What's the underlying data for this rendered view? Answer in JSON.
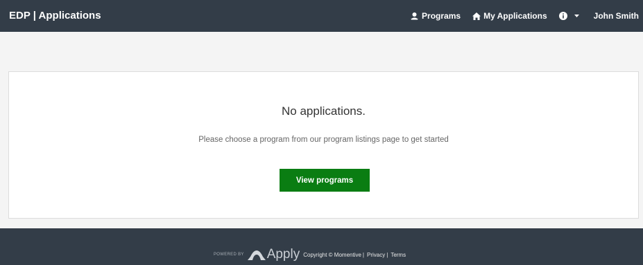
{
  "header": {
    "brand": "EDP | Applications",
    "nav": {
      "programs": "Programs",
      "my_applications": "My Applications",
      "user": "John Smith"
    },
    "icons": {
      "programs": "programs-icon",
      "my_applications": "home-icon",
      "info": "info-icon"
    }
  },
  "main": {
    "title": "No applications.",
    "message": "Please choose a program from our program listings page to get started",
    "button_label": "View programs"
  },
  "footer": {
    "powered_by": "POWERED BY",
    "logo_text": "Apply",
    "copyright": "Copyright © Momentive",
    "privacy": "Privacy",
    "separator": "|",
    "terms": "Terms"
  },
  "colors": {
    "navbar_bg": "#333d48",
    "button_bg": "#0a7d12",
    "page_bg": "#f4f4f4"
  }
}
